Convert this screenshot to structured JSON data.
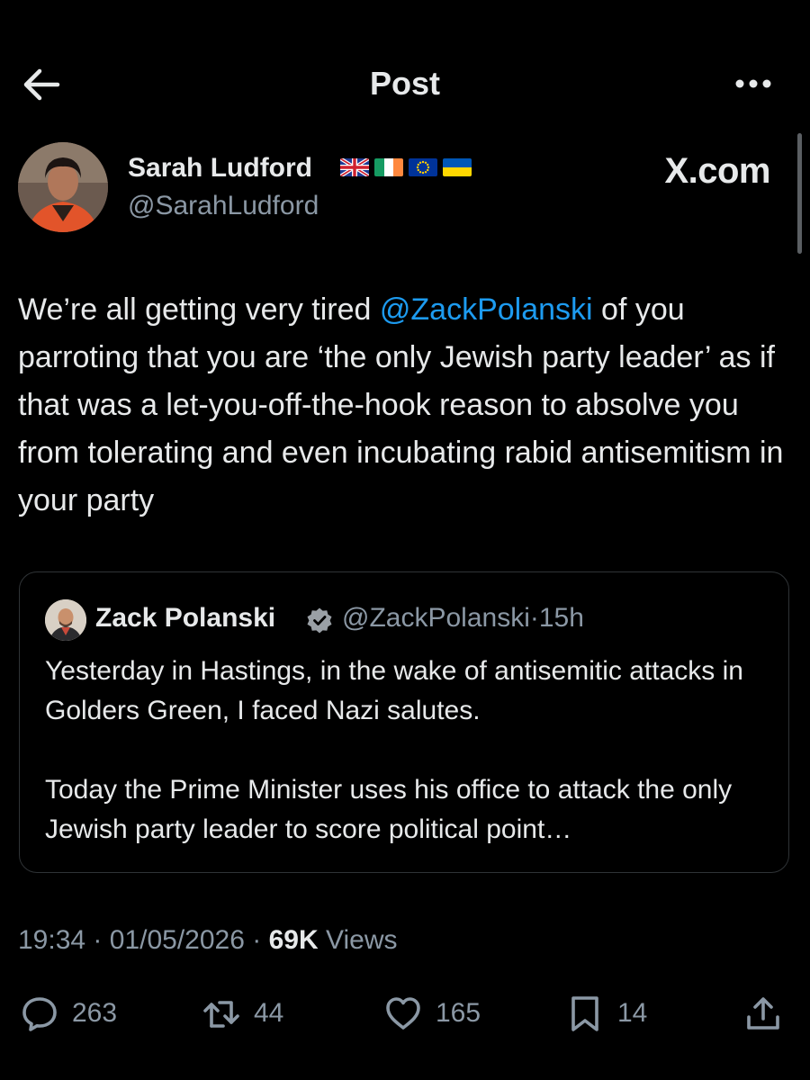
{
  "header": {
    "title": "Post",
    "back_icon": "arrow-left-icon",
    "more_icon": "more-horizontal-icon"
  },
  "post": {
    "author_name": "Sarah Ludford",
    "author_handle": "@SarahLudford",
    "flags": [
      "uk-flag-icon",
      "ireland-flag-icon",
      "eu-flag-icon",
      "ukraine-flag-icon"
    ],
    "source_label": "X.com",
    "text_before_mention": "We’re all getting very tired ",
    "mention": "@ZackPolanski",
    "text_after_mention": " of you parroting that you are ‘the only Jewish party leader’ as if that was a let-you-off-the-hook reason to absolve you from tolerating  and even incubating rabid antisemitism in your party",
    "time": "19:34",
    "date": "01/05/2026",
    "views_count": "69K",
    "views_label": "Views",
    "sep": "·"
  },
  "quote": {
    "author_name": "Zack Polanski",
    "author_handle": "@ZackPolanski",
    "sep": "·",
    "age": "15h",
    "paragraph1": "Yesterday in Hastings, in the wake of antisemitic attacks in Golders Green, I faced Nazi salutes.",
    "paragraph2": "Today the Prime Minister uses his office to attack the only Jewish party leader to score political point…"
  },
  "actions": {
    "replies": "263",
    "reposts": "44",
    "likes": "165",
    "bookmarks": "14"
  },
  "colors": {
    "background": "#000000",
    "text": "#e7e9ea",
    "secondary": "#8b98a5",
    "accent": "#1d9bf0",
    "border": "#2f3336"
  }
}
